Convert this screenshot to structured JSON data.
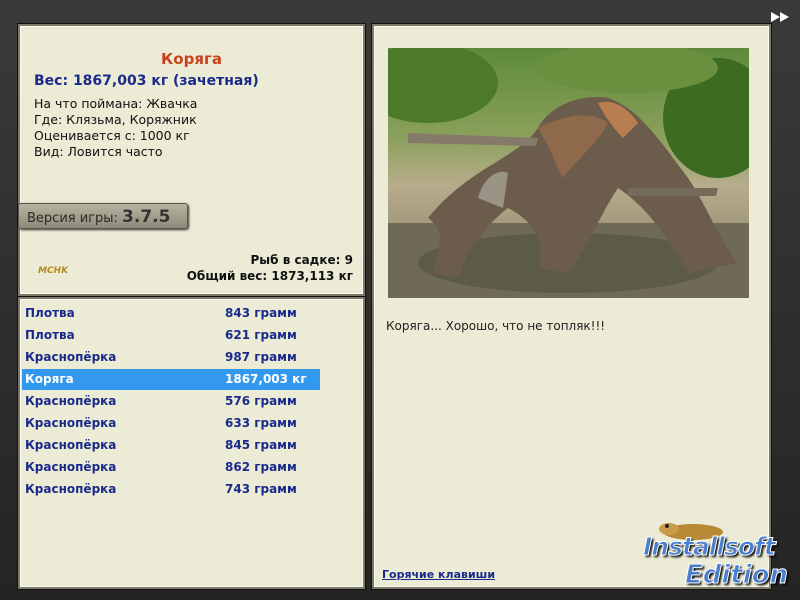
{
  "fish": {
    "title": "Коряга",
    "weight": "Вес: 1867,003 кг (зачетная)",
    "bait": "На что поймана: Жвачка",
    "location": "Где: Клязьма, Коряжник",
    "rated_from": "Оценивается с: 1000 кг",
    "kind": "Вид: Ловится часто"
  },
  "version": {
    "label": "Версия игры:",
    "number": "3.7.5"
  },
  "logo_small": "MCHK",
  "keepnet": {
    "count": "Рыб в садке: 9",
    "total": "Общий вес: 1873,113 кг"
  },
  "catch_list": [
    {
      "name": "Плотва",
      "weight": "843 грамм"
    },
    {
      "name": "Плотва",
      "weight": "621 грамм"
    },
    {
      "name": "Краснопёрка",
      "weight": "987 грамм"
    },
    {
      "name": "Коряга",
      "weight": "1867,003 кг",
      "selected": true
    },
    {
      "name": "Краснопёрка",
      "weight": "576 грамм"
    },
    {
      "name": "Краснопёрка",
      "weight": "633 грамм"
    },
    {
      "name": "Краснопёрка",
      "weight": "845 грамм"
    },
    {
      "name": "Краснопёрка",
      "weight": "862 грамм"
    },
    {
      "name": "Краснопёрка",
      "weight": "743 грамм"
    }
  ],
  "detail_panel": {
    "caption": "Коряга... Хорошо, что не топляк!!!",
    "hotkeys": "Горячие клавиши"
  },
  "nav": {
    "next_icon": "double-arrow-right-icon"
  },
  "brand": {
    "line1": "Installsoft",
    "line2": "Edition"
  },
  "colors": {
    "panel_bg": "#ecebd6",
    "highlight": "#3399ee",
    "title": "#c9421c",
    "text_blue": "#1a2a8a"
  }
}
